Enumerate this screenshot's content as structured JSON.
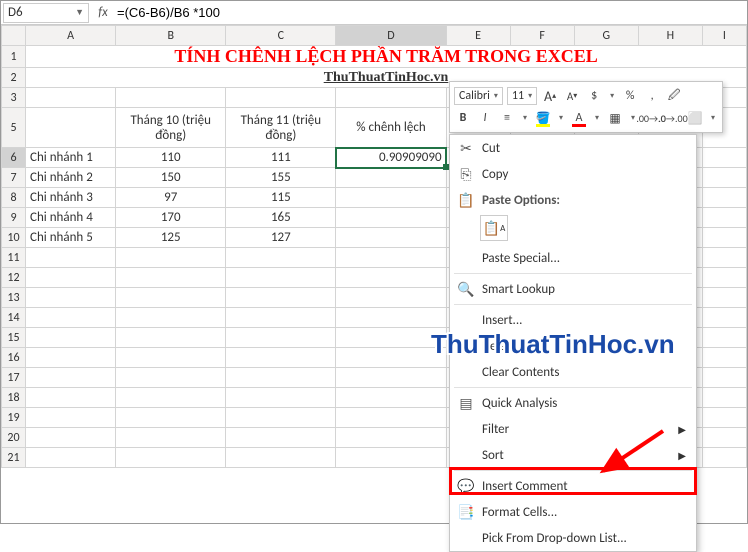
{
  "namebox": {
    "ref": "D6"
  },
  "formula": "=(C6-B6)/B6 *100",
  "columns": [
    "A",
    "B",
    "C",
    "D",
    "E",
    "F",
    "G",
    "H",
    "I"
  ],
  "title": "TÍNH CHÊNH LỆCH PHẦN TRĂM TRONG EXCEL",
  "subtitle": "ThuThuatTinHoc.vn",
  "headers": {
    "col_b": "Tháng 10 (triệu đồng)",
    "col_c": "Tháng 11 (triệu đồng)",
    "col_d": "% chênh lệch"
  },
  "rows": [
    {
      "label": "Chi nhánh 1",
      "b": "110",
      "c": "111",
      "d": "0.90909090"
    },
    {
      "label": "Chi nhánh 2",
      "b": "150",
      "c": "155",
      "d": ""
    },
    {
      "label": "Chi nhánh 3",
      "b": "97",
      "c": "115",
      "d": ""
    },
    {
      "label": "Chi nhánh 4",
      "b": "170",
      "c": "165",
      "d": ""
    },
    {
      "label": "Chi nhánh 5",
      "b": "125",
      "c": "127",
      "d": ""
    }
  ],
  "mini": {
    "font": "Calibri",
    "size": "11",
    "inc": "A",
    "dec": "A"
  },
  "ctx": {
    "cut": "Cut",
    "copy": "Copy",
    "paste_head": "Paste Options:",
    "paste_special": "Paste Special...",
    "smart": "Smart Lookup",
    "insert": "Insert...",
    "delete": "Delete...",
    "clear": "Clear Contents",
    "quick": "Quick Analysis",
    "filter": "Filter",
    "sort": "Sort",
    "comment": "Insert Comment",
    "format": "Format Cells...",
    "picklist": "Pick From Drop-down List..."
  },
  "watermark": "ThuThuatTinHoc.vn"
}
